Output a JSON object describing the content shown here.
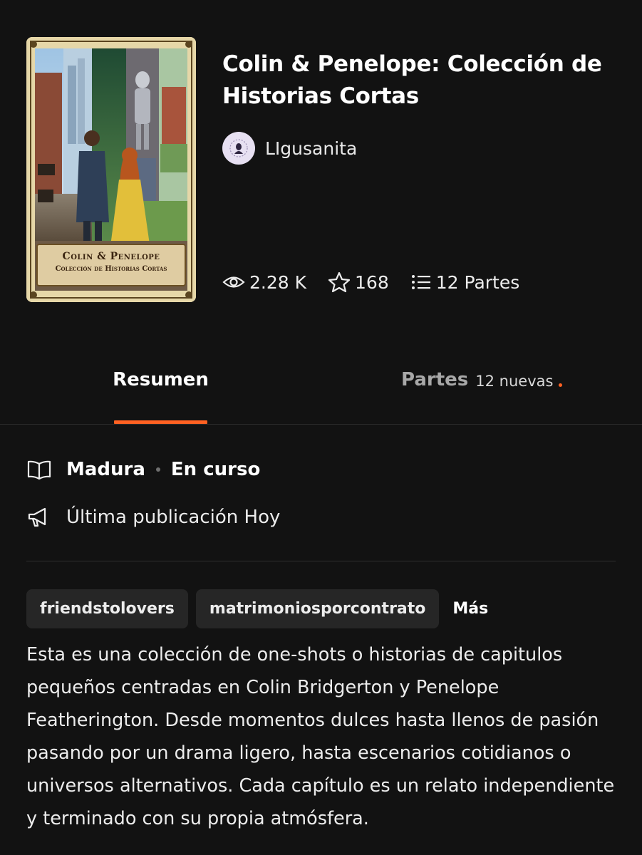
{
  "story": {
    "title": "Colin & Penelope: Colección de Historias Cortas",
    "author": "LIgusanita",
    "cover": {
      "title_line_1": "Colin & Penelope",
      "title_line_2": "Colección de Historias Cortas"
    }
  },
  "stats": {
    "reads": "2.28 K",
    "votes": "168",
    "parts": "12 Partes",
    "icons": [
      "eye-icon",
      "star-icon",
      "list-icon"
    ]
  },
  "tabs": {
    "summary_label": "Resumen",
    "parts_label": "Partes",
    "parts_badge": "12 nuevas"
  },
  "meta": {
    "rating": "Madura",
    "status": "En curso",
    "last_published": "Última publicación Hoy"
  },
  "tags": {
    "items": [
      "friendstolovers",
      "matrimoniosporcontrato"
    ],
    "more_label": "Más"
  },
  "description": "Esta es una colección de one-shots o historias de capitulos pequeños centradas en Colin Bridgerton y Penelope Featherington. Desde momentos dulces hasta llenos de pasión pasando por un drama ligero, hasta escenarios cotidianos o universos alternativos. Cada capítulo es un relato independiente y terminado con su propia atmósfera.",
  "colors": {
    "background": "#121212",
    "accent": "#ff6122",
    "tag_background": "#262626"
  }
}
